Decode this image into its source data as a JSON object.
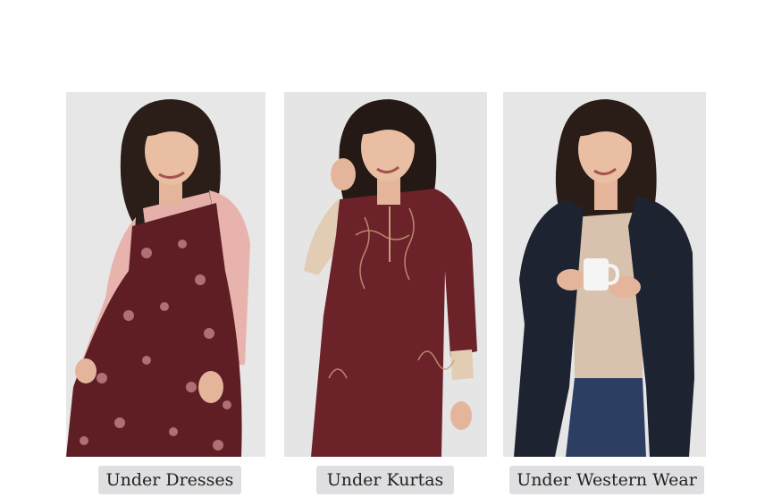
{
  "categories": [
    {
      "label": "Under Dresses",
      "image": "Woman in wine floral strappy dress over pink long-sleeve top"
    },
    {
      "label": "Under Kurtas",
      "image": "Woman in maroon embroidered kurta with beige inner sleeves"
    },
    {
      "label": "Under Western Wear",
      "image": "Woman in navy long coat over beige top holding a white mug"
    }
  ],
  "colors": {
    "card_background": "#e6e5e6",
    "pill_background": "#dfdfe1",
    "pill_text": "#222222"
  }
}
